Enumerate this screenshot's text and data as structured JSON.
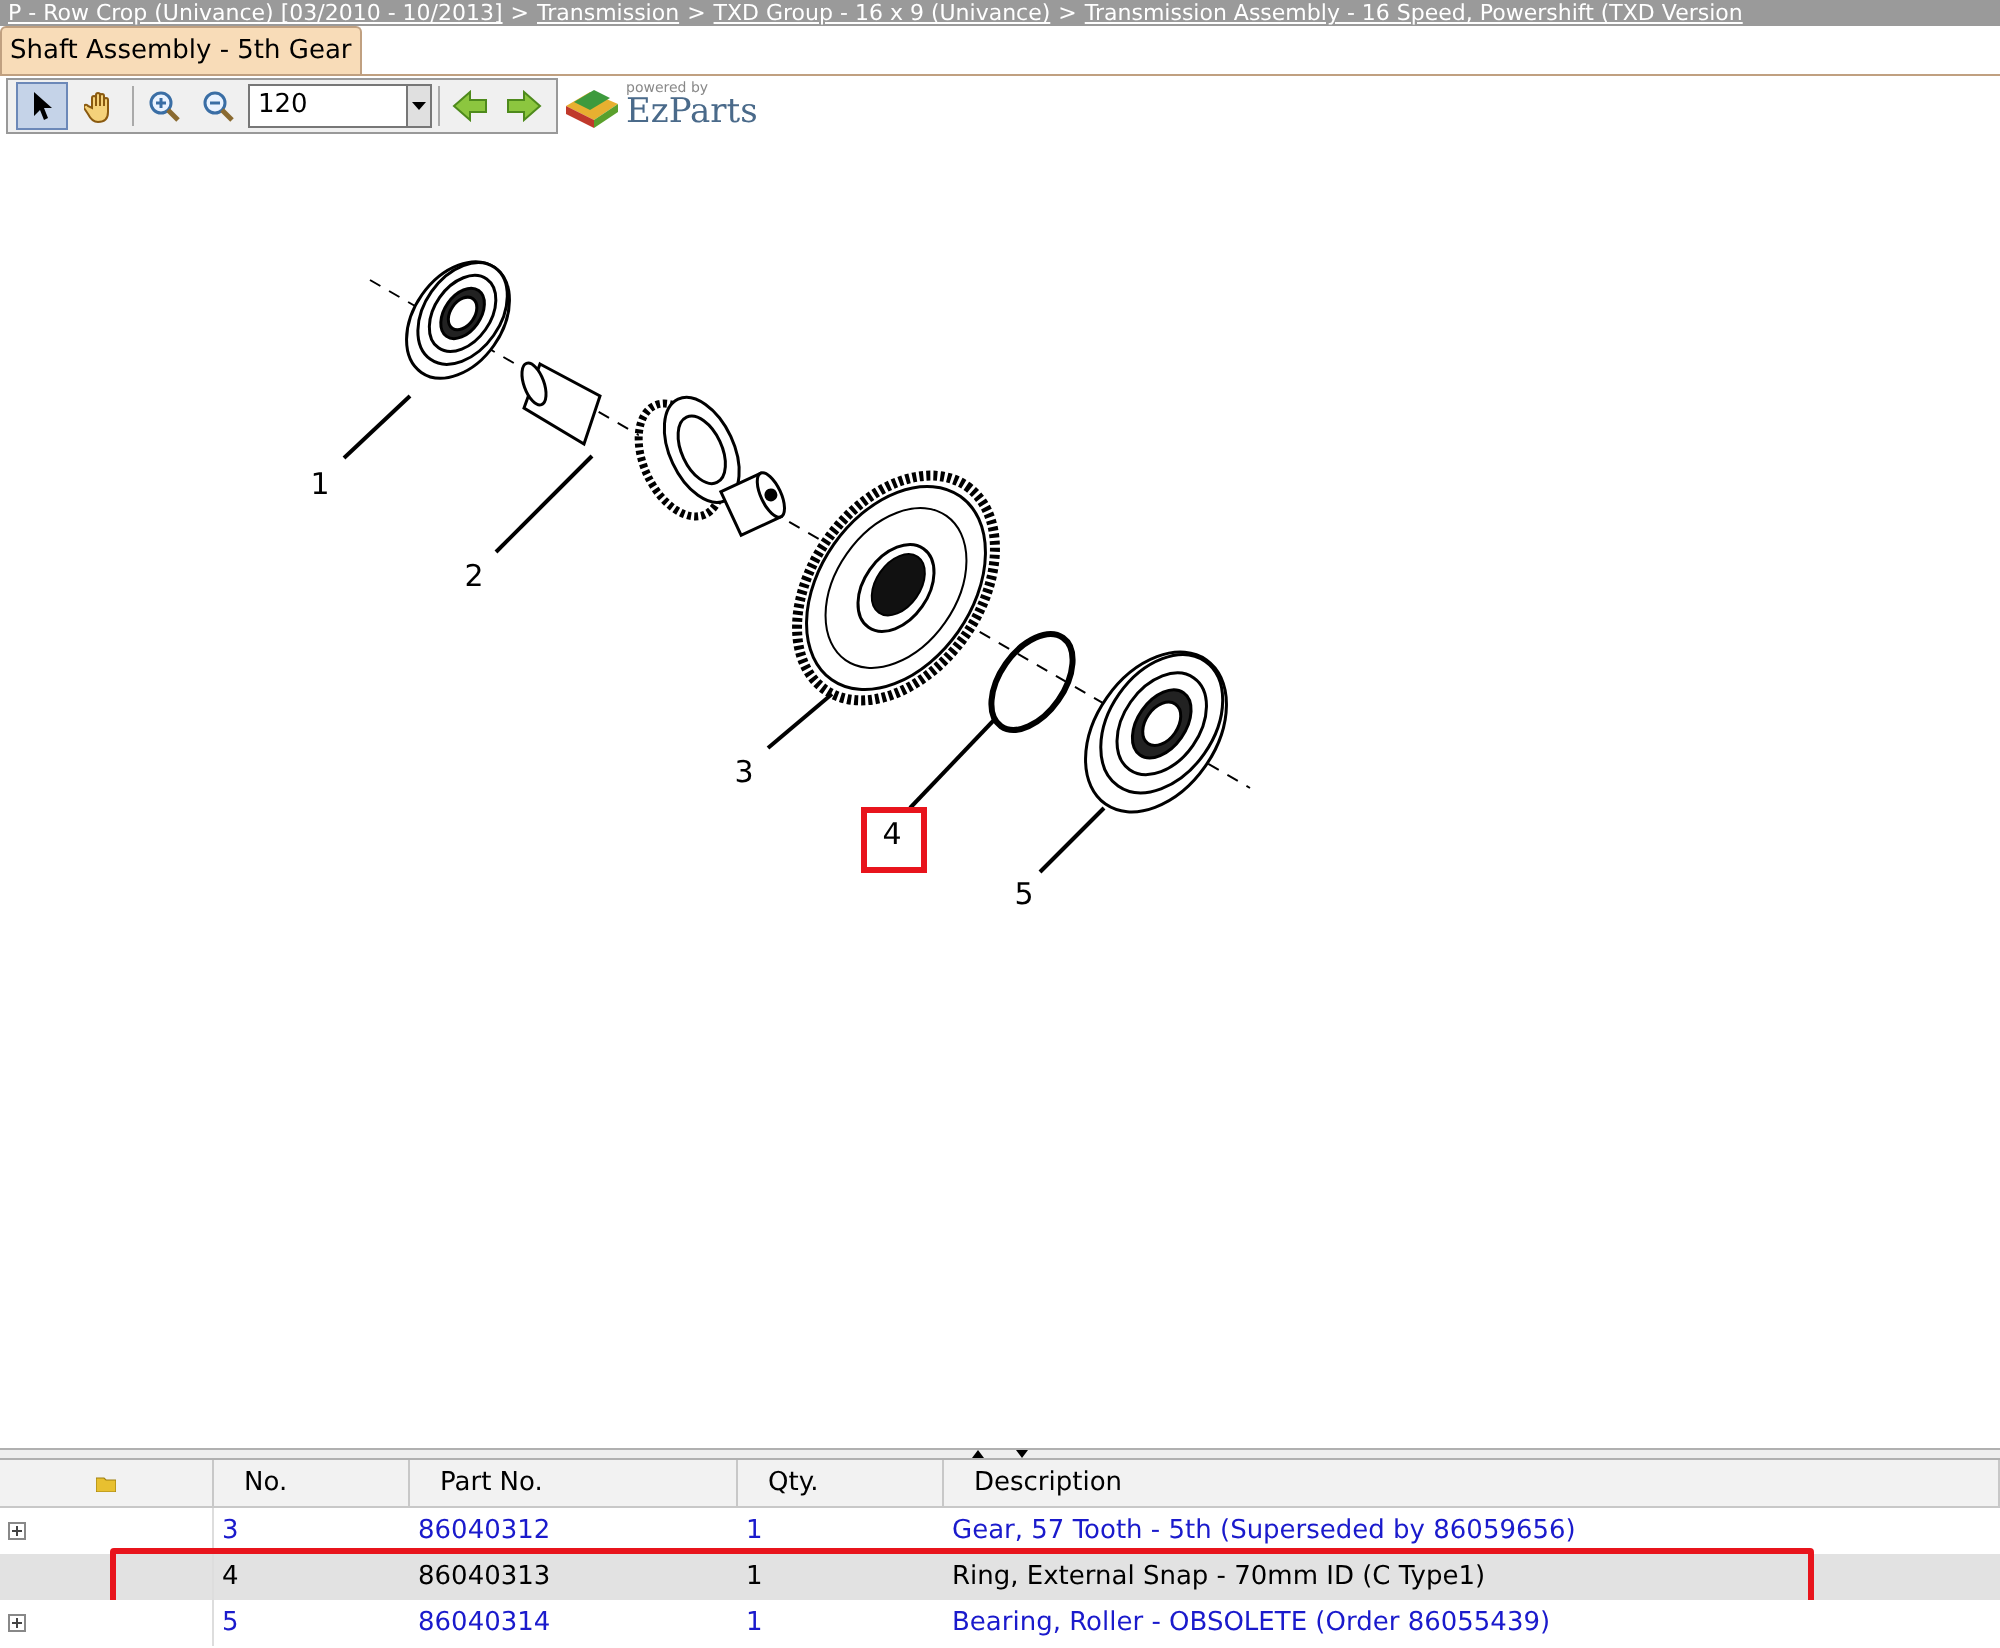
{
  "breadcrumb": [
    "P - Row Crop  (Univance) [03/2010 - 10/2013]",
    "Transmission",
    "TXD Group - 16 x 9 (Univance)",
    "Transmission Assembly - 16 Speed, Powershift (TXD Version"
  ],
  "breadcrumb_separator": ">",
  "tab": {
    "label": "Shaft Assembly - 5th Gear",
    "selected": true
  },
  "toolbar": {
    "zoom": "120",
    "logo_caption": "powered by",
    "logo": "EzParts"
  },
  "diagram": {
    "callouts": [
      {
        "label": "1",
        "selected": false
      },
      {
        "label": "2",
        "selected": false
      },
      {
        "label": "3",
        "selected": false
      },
      {
        "label": "4",
        "selected": true
      },
      {
        "label": "5",
        "selected": false
      }
    ]
  },
  "table": {
    "columns": [
      "No.",
      "Part No.",
      "Qty.",
      "Description"
    ],
    "rows": [
      {
        "no": "3",
        "part_no": "86040312",
        "qty": "1",
        "description": "Gear, 57 Tooth - 5th (Superseded by 86059656)",
        "expandable": true,
        "selected": false
      },
      {
        "no": "4",
        "part_no": "86040313",
        "qty": "1",
        "description": "Ring, External Snap - 70mm ID (C Type1)",
        "expandable": false,
        "selected": true
      },
      {
        "no": "5",
        "part_no": "86040314",
        "qty": "1",
        "description": "Bearing, Roller - OBSOLETE (Order 86055439)",
        "expandable": true,
        "selected": false
      }
    ]
  }
}
